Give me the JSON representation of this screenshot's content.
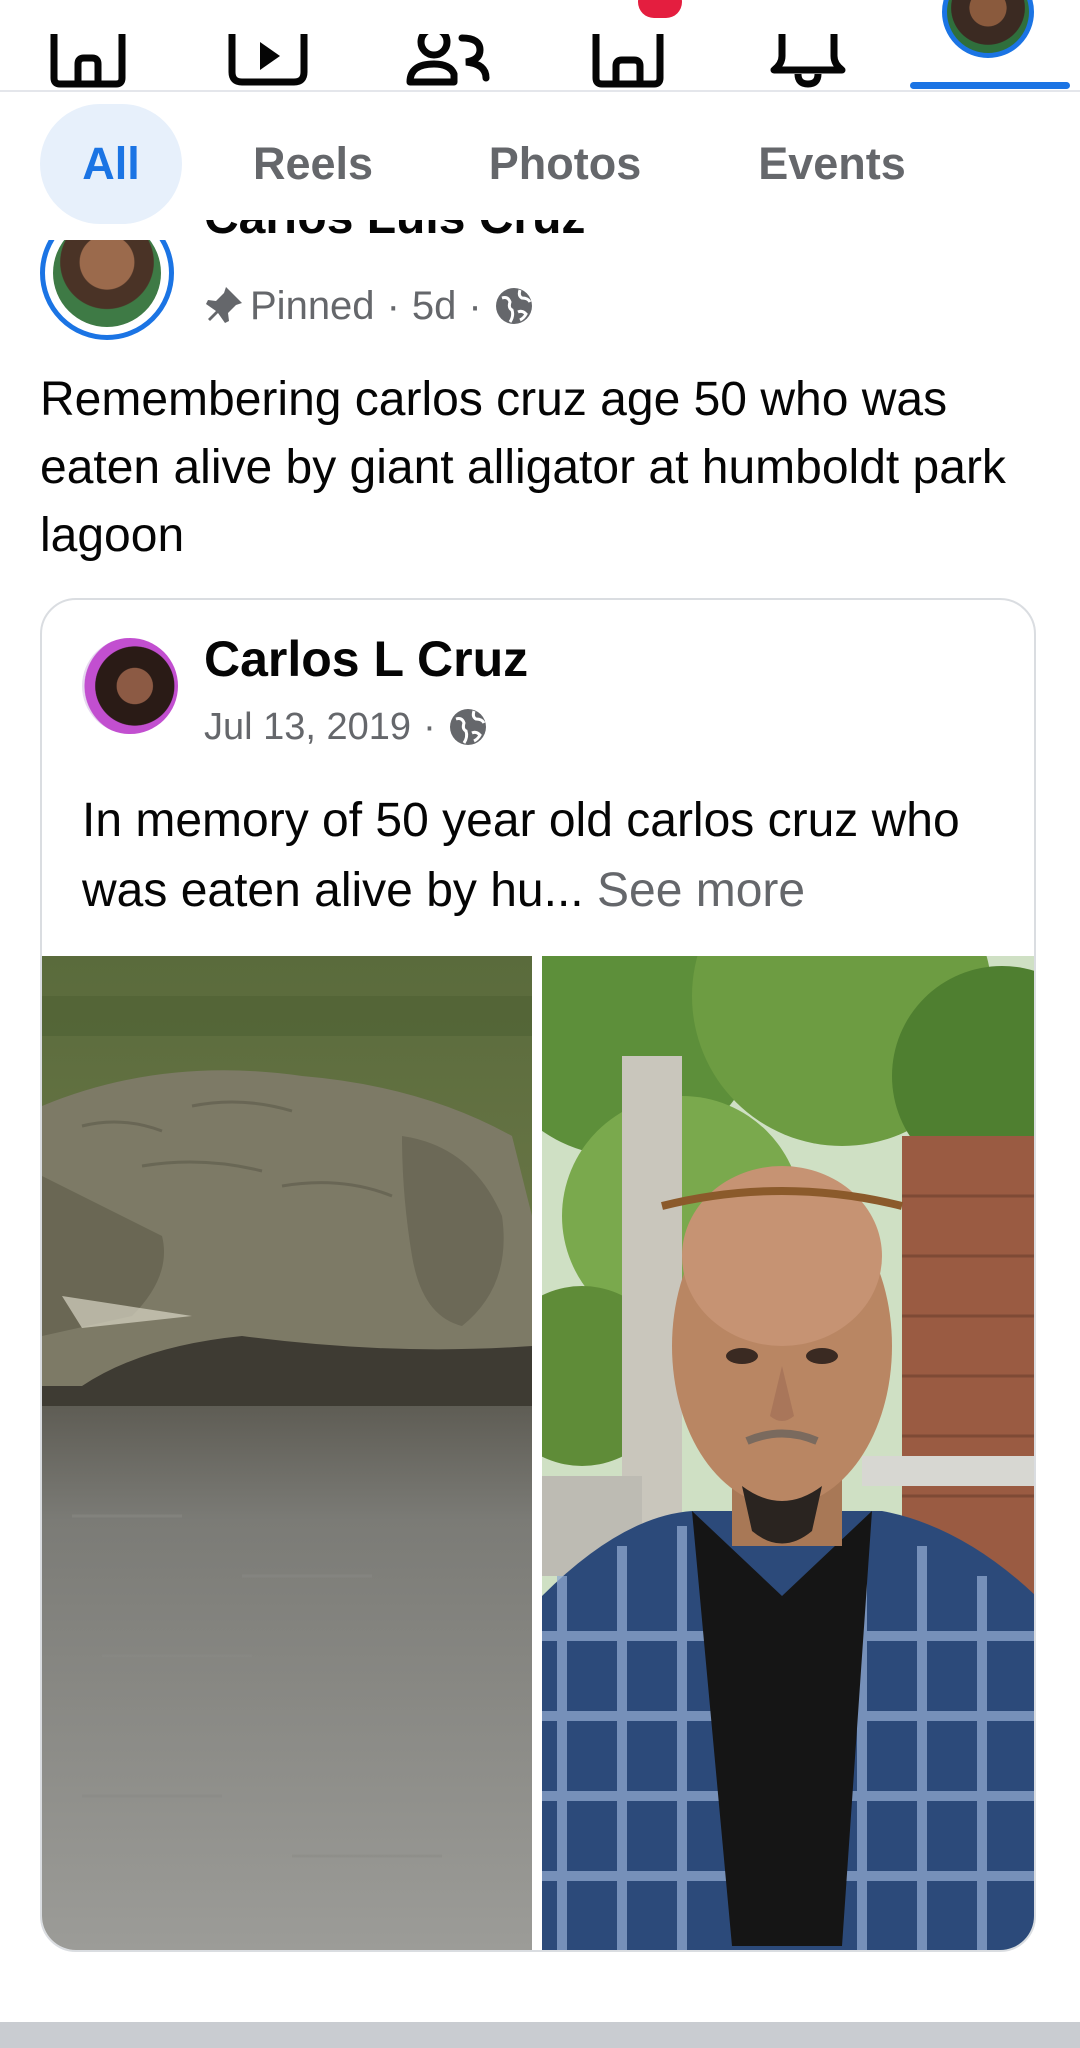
{
  "nav": {
    "items": [
      {
        "name": "home-tab",
        "icon": "home-icon"
      },
      {
        "name": "video-tab",
        "icon": "video-icon"
      },
      {
        "name": "friends-tab",
        "icon": "friends-icon"
      },
      {
        "name": "marketplace-tab",
        "icon": "marketplace-icon"
      },
      {
        "name": "notifications-tab",
        "icon": "bell-icon"
      },
      {
        "name": "profile-tab",
        "icon": "profile-avatar"
      }
    ],
    "active": "profile-tab",
    "accent": "#1b74e4",
    "badge_color": "#e41e3f"
  },
  "filters": {
    "tabs": [
      {
        "label": "All",
        "active": true
      },
      {
        "label": "Reels",
        "active": false
      },
      {
        "label": "Photos",
        "active": false
      },
      {
        "label": "Events",
        "active": false
      }
    ]
  },
  "post": {
    "author": "Carlos Luis Cruz",
    "pinned_label": "Pinned",
    "age": "5d",
    "separator": "·",
    "privacy_icon": "globe-icon",
    "text": "Remembering carlos cruz age 50 who was eaten alive by giant alligator at humboldt park lagoon"
  },
  "shared": {
    "author": "Carlos L Cruz",
    "date": "Jul 13, 2019",
    "separator": "·",
    "privacy_icon": "globe-icon",
    "text": "In memory of 50 year old carlos cruz who was eaten alive by hu...",
    "see_more": "See more",
    "photos": [
      {
        "subject": "alligator-photo"
      },
      {
        "subject": "man-selfie-photo"
      }
    ]
  }
}
